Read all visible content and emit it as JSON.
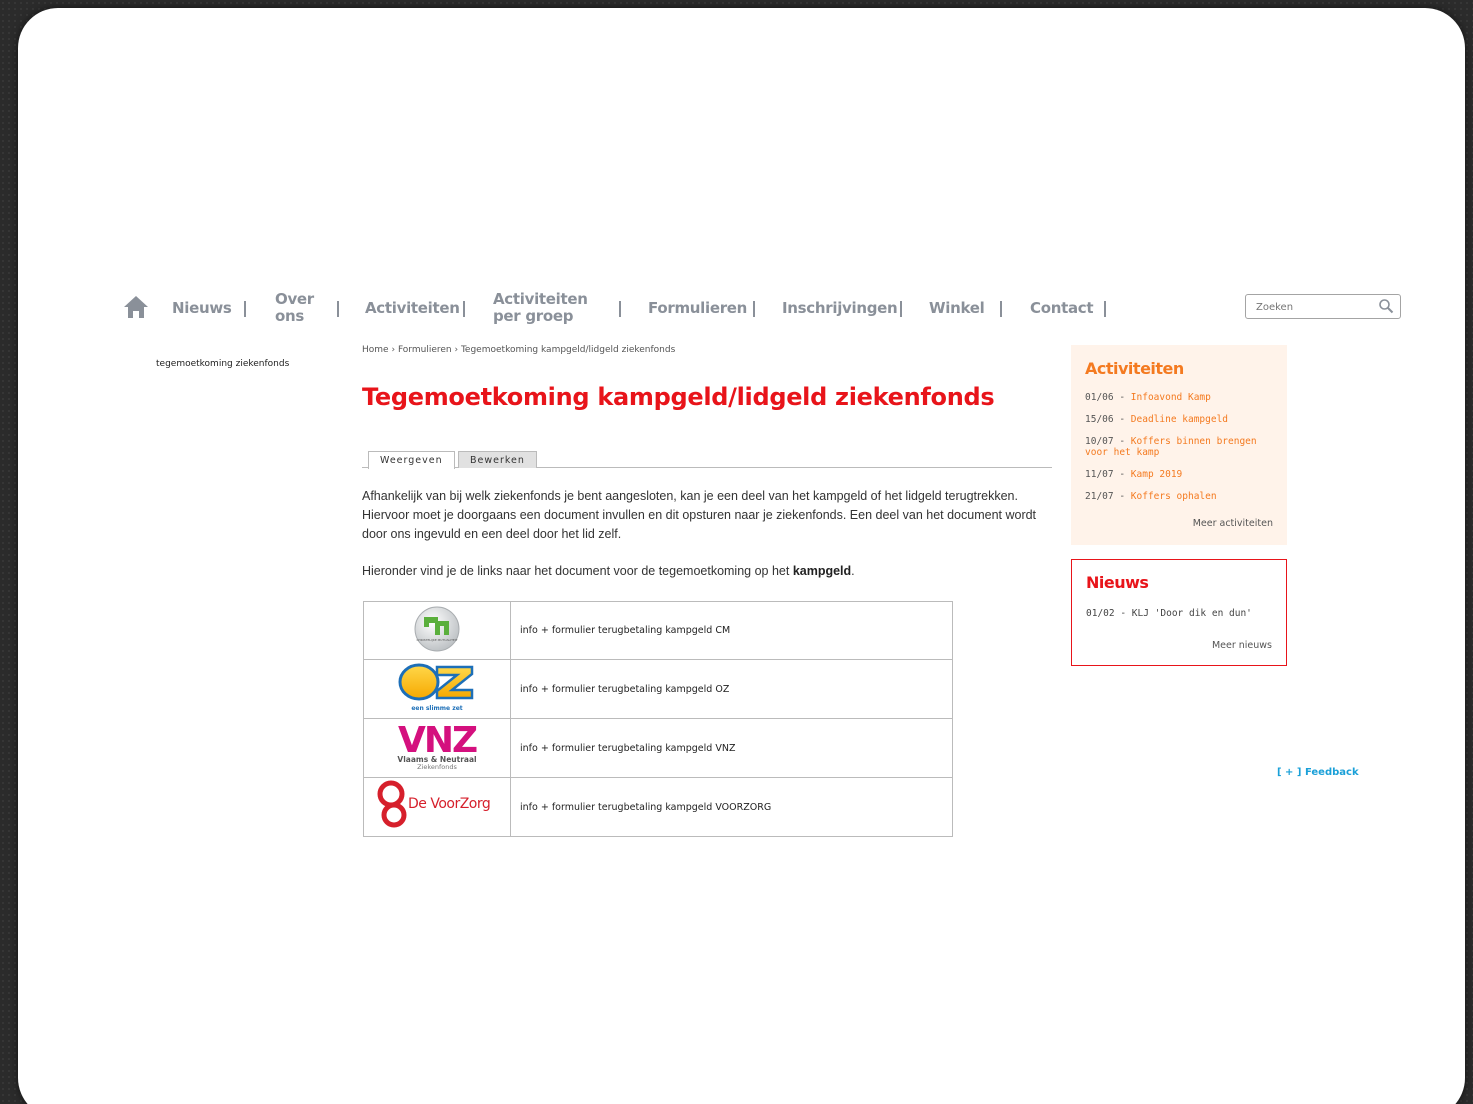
{
  "nav": {
    "home_icon": "home-icon",
    "items": [
      {
        "label": "Nieuws"
      },
      {
        "label_1": "Over",
        "label_2": "ons"
      },
      {
        "label": "Activiteiten"
      },
      {
        "label_1": "Activiteiten",
        "label_2": "per groep"
      },
      {
        "label": "Formulieren"
      },
      {
        "label": "Inschrijvingen"
      },
      {
        "label": "Winkel"
      },
      {
        "label": "Contact"
      }
    ],
    "search_placeholder": "Zoeken",
    "color": "#8a9099"
  },
  "left_menu": {
    "active_item": "tegemoetkoming ziekenfonds"
  },
  "breadcrumb": {
    "home": "Home",
    "sep": "›",
    "formulieren": "Formulieren",
    "current": "Tegemoetkoming kampgeld/lidgeld ziekenfonds"
  },
  "page": {
    "title": "Tegemoetkoming kampgeld/lidgeld ziekenfonds",
    "title_color": "#e8141a",
    "tabs": {
      "view": "Weergeven",
      "edit": "Bewerken"
    },
    "paragraph_1": "Afhankelijk van bij welk ziekenfonds je bent aangesloten, kan je een deel van het kampgeld of het lidgeld terugtrekken. Hiervoor moet je doorgaans een document invullen en dit opsturen naar je ziekenfonds. Een deel van het document wordt door ons ingevuld en een deel door het lid zelf.",
    "paragraph_2_prefix": "Hieronder vind je de links naar het document voor de tegemoetkoming op het ",
    "paragraph_2_bold": "kampgeld",
    "paragraph_2_suffix": "."
  },
  "funds": [
    {
      "logo": "cm-logo",
      "logo_text": "CHRISTELIJKE MUTUALITEIT",
      "link": "info + formulier terugbetaling kampgeld CM"
    },
    {
      "logo": "oz-logo",
      "logo_text": "OZ",
      "logo_subtext": "een slimme zet",
      "link": "info + formulier terugbetaling kampgeld OZ"
    },
    {
      "logo": "vnz-logo",
      "logo_text": "VNZ",
      "logo_subtext_1": "Vlaams & Neutraal",
      "logo_subtext_2": "Ziekenfonds",
      "link": "info + formulier terugbetaling kampgeld VNZ"
    },
    {
      "logo": "voorzorg-logo",
      "logo_text": "De VoorZorg",
      "link": "info + formulier terugbetaling kampgeld VOORZORG"
    }
  ],
  "sidebar": {
    "activities": {
      "title": "Activiteiten",
      "color": "#f47a20",
      "items": [
        {
          "date": "01/06",
          "title": "Infoavond Kamp"
        },
        {
          "date": "15/06",
          "title": "Deadline kampgeld"
        },
        {
          "date": "10/07",
          "title": "Koffers binnen brengen voor het kamp"
        },
        {
          "date": "11/07",
          "title": "Kamp 2019"
        },
        {
          "date": "21/07",
          "title": "Koffers ophalen"
        }
      ],
      "more": "Meer activiteiten"
    },
    "news": {
      "title": "Nieuws",
      "color": "#e8141a",
      "items": [
        {
          "date": "01/02",
          "title": "KLJ 'Door dik en dun'"
        }
      ],
      "more": "Meer nieuws"
    }
  },
  "feedback": "[ + ] Feedback"
}
